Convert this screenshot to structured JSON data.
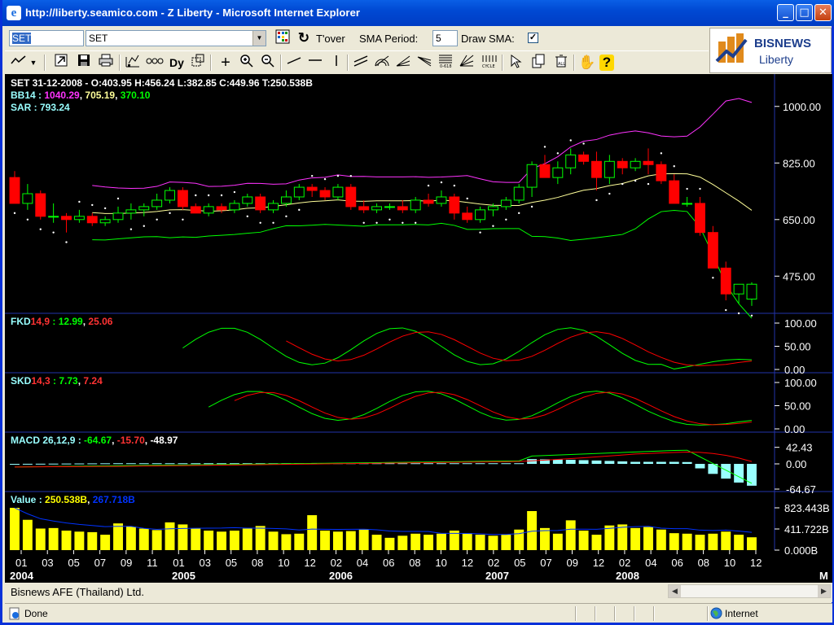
{
  "window": {
    "title": "http://liberty.seamico.com - Z Liberty - Microsoft Internet Explorer",
    "minimize": "_",
    "maximize": "□",
    "close": "✕"
  },
  "toolbar": {
    "symbol_input": "SET",
    "symbol_select": "SET",
    "turnover_label": "T'over",
    "sma_period_label": "SMA Period:",
    "sma_period_value": "5",
    "draw_sma_label": "Draw SMA:",
    "draw_sma_checked": "✓",
    "icons": [
      "line-chart-icon",
      "dropdown-arrow-icon",
      "open-icon",
      "save-icon",
      "print-icon",
      "indicator-icon",
      "compare-icon",
      "dy-icon",
      "resize-icon",
      "crosshair-icon",
      "zoom-in-icon",
      "zoom-out-icon",
      "trendline-icon",
      "horizontal-line-icon",
      "vertical-line-icon",
      "parallel-lines-icon",
      "fibonacci-arc-icon",
      "fan-icon",
      "speed-line-icon",
      "fibonacci-retracement-icon",
      "gann-icon",
      "cycle-icon",
      "select-icon",
      "copy-icon",
      "delete-all-icon",
      "pan-hand-icon",
      "help-icon"
    ],
    "dy_label": "Dy"
  },
  "brand": {
    "name": "BISNEWS",
    "sub": "Liberty"
  },
  "chart": {
    "price_header": "SET 31-12-2008 - O:403.95 H:456.24 L:382.85 C:449.96 T:250.538B",
    "bb_label": "BB14 : ",
    "bb_upper": "1040.29",
    "bb_mid": "705.19",
    "bb_lower": "370.10",
    "sar_label": "SAR : 793.24",
    "fkd_label": "FKD",
    "fkd_params": "14,9",
    "fkd_k": " : 12.99",
    "fkd_d": "25.06",
    "skd_label": "SKD",
    "skd_params": "14,3",
    "skd_k": " : 7.73",
    "skd_d": "7.24",
    "macd_label": "MACD 26,12,9 : ",
    "macd_line": "-64.67",
    "macd_signal": "-15.70",
    "macd_hist": "-48.97",
    "value_label": "Value : ",
    "value_main": "250.538B",
    "value_avg": "267.718B",
    "price_axis": [
      "1000.00",
      "825.00",
      "650.00",
      "475.00"
    ],
    "osc_axis": [
      "100.00",
      "50.00",
      "0.00"
    ],
    "macd_axis": [
      "42.43",
      "0.00",
      "-64.67"
    ],
    "vol_axis": [
      "823.443B",
      "411.722B",
      "0.000B"
    ],
    "month_ticks": [
      "01",
      "03",
      "05",
      "07",
      "09",
      "11",
      "01",
      "03",
      "05",
      "08",
      "10",
      "12",
      "02",
      "04",
      "06",
      "08",
      "10",
      "12",
      "02",
      "05",
      "07",
      "09",
      "12",
      "02",
      "04",
      "06",
      "08",
      "10",
      "12"
    ],
    "years": [
      "2004",
      "2005",
      "2006",
      "2007",
      "2008"
    ],
    "period_marker": "M",
    "colors": {
      "up": "#00ff00",
      "down": "#ff0000",
      "bb_upper": "#ff33ff",
      "bb_mid": "#ffff99",
      "bb_lower": "#00ff00",
      "sar": "#ffffff",
      "volume": "#ffff00",
      "macd_hist": "#99ffff"
    }
  },
  "chart_data": {
    "type": "candlestick",
    "title": "SET",
    "interval": "monthly",
    "x_range": [
      "2004-01",
      "2008-12"
    ],
    "price_axis_ticks": [
      475,
      650,
      825,
      1000
    ],
    "ohlc": [
      [
        780,
        800,
        700,
        700
      ],
      [
        700,
        760,
        680,
        730
      ],
      [
        730,
        740,
        650,
        660
      ],
      [
        660,
        700,
        640,
        660
      ],
      [
        660,
        670,
        610,
        650
      ],
      [
        650,
        680,
        640,
        660
      ],
      [
        660,
        670,
        630,
        640
      ],
      [
        640,
        660,
        630,
        650
      ],
      [
        650,
        690,
        640,
        670
      ],
      [
        670,
        700,
        650,
        680
      ],
      [
        680,
        700,
        660,
        690
      ],
      [
        690,
        730,
        680,
        710
      ],
      [
        710,
        750,
        700,
        740
      ],
      [
        740,
        750,
        680,
        690
      ],
      [
        690,
        700,
        670,
        670
      ],
      [
        670,
        700,
        660,
        690
      ],
      [
        690,
        700,
        670,
        680
      ],
      [
        680,
        710,
        670,
        700
      ],
      [
        700,
        730,
        690,
        720
      ],
      [
        720,
        730,
        670,
        680
      ],
      [
        680,
        710,
        670,
        700
      ],
      [
        700,
        740,
        690,
        720
      ],
      [
        720,
        760,
        710,
        750
      ],
      [
        750,
        760,
        720,
        740
      ],
      [
        740,
        750,
        710,
        720
      ],
      [
        720,
        760,
        710,
        750
      ],
      [
        750,
        760,
        680,
        690
      ],
      [
        690,
        710,
        670,
        680
      ],
      [
        680,
        700,
        670,
        690
      ],
      [
        690,
        700,
        680,
        690
      ],
      [
        690,
        710,
        670,
        680
      ],
      [
        680,
        720,
        670,
        710
      ],
      [
        710,
        730,
        690,
        700
      ],
      [
        700,
        740,
        690,
        720
      ],
      [
        720,
        730,
        650,
        670
      ],
      [
        670,
        690,
        640,
        650
      ],
      [
        650,
        690,
        640,
        680
      ],
      [
        680,
        700,
        660,
        690
      ],
      [
        690,
        720,
        680,
        710
      ],
      [
        710,
        760,
        700,
        750
      ],
      [
        750,
        830,
        720,
        820
      ],
      [
        820,
        850,
        780,
        780
      ],
      [
        780,
        830,
        760,
        810
      ],
      [
        810,
        870,
        790,
        850
      ],
      [
        850,
        860,
        820,
        830
      ],
      [
        830,
        860,
        740,
        780
      ],
      [
        780,
        850,
        760,
        830
      ],
      [
        830,
        840,
        790,
        810
      ],
      [
        810,
        840,
        800,
        830
      ],
      [
        830,
        870,
        790,
        820
      ],
      [
        820,
        830,
        760,
        770
      ],
      [
        770,
        790,
        700,
        700
      ],
      [
        700,
        720,
        690,
        700
      ],
      [
        700,
        720,
        600,
        610
      ],
      [
        610,
        630,
        500,
        500
      ],
      [
        500,
        520,
        400,
        420
      ],
      [
        420,
        440,
        390,
        450
      ],
      [
        404,
        456,
        383,
        450
      ]
    ],
    "indicators": {
      "BB14": {
        "upper": 1040.29,
        "mid": 705.19,
        "lower": 370.1
      },
      "SAR": 793.24,
      "FKD14_9": {
        "k": 12.99,
        "d": 25.06
      },
      "SKD14_3": {
        "k": 7.73,
        "d": 7.24
      },
      "MACD26_12_9": {
        "macd": -64.67,
        "signal": -15.7,
        "hist": -48.97
      },
      "Value": {
        "last": "250.538B",
        "avg": "267.718B"
      }
    }
  },
  "footer": {
    "company": "Bisnews AFE (Thailand) Ltd."
  },
  "status": {
    "text": "Done",
    "zone": "Internet"
  }
}
